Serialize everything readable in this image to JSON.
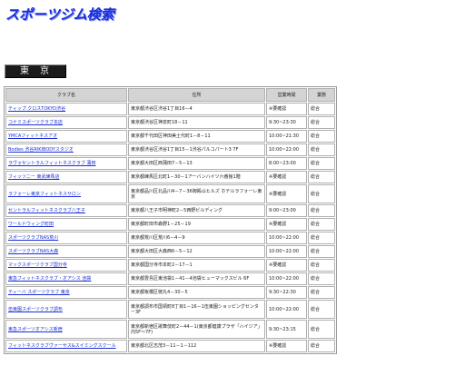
{
  "site": {
    "title": "スポーツジム検索"
  },
  "region": {
    "label": "東京"
  },
  "table": {
    "headers": {
      "name": "クラブ名",
      "address": "住所",
      "hours": "営業時間",
      "type": "業態"
    },
    "rows": [
      {
        "name": "ティップ.クロスTOKYO渋谷",
        "address": "東京都渋谷区渋谷1丁目16－4",
        "hours": "※要確認",
        "type": "総合",
        "tall": false
      },
      {
        "name": "コナミスポーツクラブ本店",
        "address": "東京都渋谷区神泉町18－11",
        "hours": "9:30~23:30",
        "type": "総合",
        "tall": false
      },
      {
        "name": "YMCAフィットネスアオ",
        "address": "東京都千代田区神田美土代町1－8－11",
        "hours": "10:00~21:30",
        "type": "総合",
        "tall": false
      },
      {
        "name": "Bodies 渋谷RIKIBODYスタジオ",
        "address": "東京都渋谷区渋谷1丁目15－1渋谷パルコパート3 7F",
        "hours": "10:00~22:00",
        "type": "総合",
        "tall": false
      },
      {
        "name": "ラヴォセントラルフィットネスクラブ 蒲田",
        "address": "東京都大田区西蒲田7－5－13",
        "hours": "8:00~23:00",
        "type": "総合",
        "tall": false
      },
      {
        "name": "フィッツニー 東武練馬店",
        "address": "東京都練馬区北町1－30－1アーバンハイツ六番館1階",
        "hours": "※要確認",
        "type": "総合",
        "tall": false
      },
      {
        "name": "ラフォーレ東京フィットネスサロン",
        "address": "東京都品川区北品川4－7－36御殿山ヒルズ ホテルラフォーレ東京",
        "hours": "※要確認",
        "type": "総合",
        "tall": true
      },
      {
        "name": "セントラルフィットネスクラブ八王子",
        "address": "東京都八王子市明神町2－5西野ビルディング",
        "hours": "9:00~23:00",
        "type": "総合",
        "tall": false
      },
      {
        "name": "ワールドウィング町田",
        "address": "東京都町田市森野1－25－19",
        "hours": "※要確認",
        "type": "総合",
        "tall": false
      },
      {
        "name": "スポーツクラブNAS荒川",
        "address": "東京都荒川区荒川6－4－9",
        "hours": "10:00~22:00",
        "type": "総合",
        "tall": false
      },
      {
        "name": "スポーツクラブNAS大森",
        "address": "東京都大田区大森西6－5－12",
        "hours": "10:00~22:00",
        "type": "総合",
        "tall": false
      },
      {
        "name": "マックスポーツクラブ国分寺",
        "address": "東京都国分寺市本町2－17－1",
        "hours": "※要確認",
        "type": "総合",
        "tall": false
      },
      {
        "name": "東急フィットネスクラブ・オアシス 池袋",
        "address": "東京都豊島区東池袋1－41－4池袋ヒューマックスビル 6F",
        "hours": "10:00~22:00",
        "type": "総合",
        "tall": false
      },
      {
        "name": "ティーバ スポーツクラブ 東京",
        "address": "東京都板橋区徳丸4－30－5",
        "hours": "9:30~22:30",
        "type": "総合",
        "tall": false
      },
      {
        "name": "伍東園スポーツクラブ調布",
        "address": "東京都調布市国領町8丁目1－16－1伍東園ショッピングセンター3F",
        "hours": "10:00~22:00",
        "type": "総合",
        "tall": true
      },
      {
        "name": "東急スポーツオアシス新宿",
        "address": "東京都新宿区歌舞伎町2－44－1(東京都健康プラザ「ハイジア」内5F～7F)",
        "hours": "9:30~23:15",
        "type": "総合",
        "tall": true
      },
      {
        "name": "フィットネスクラブヴァーサス&スイミングスクール",
        "address": "東京都北区志茂3－11－1－112",
        "hours": "※要確認",
        "type": "総合",
        "tall": false
      }
    ]
  }
}
